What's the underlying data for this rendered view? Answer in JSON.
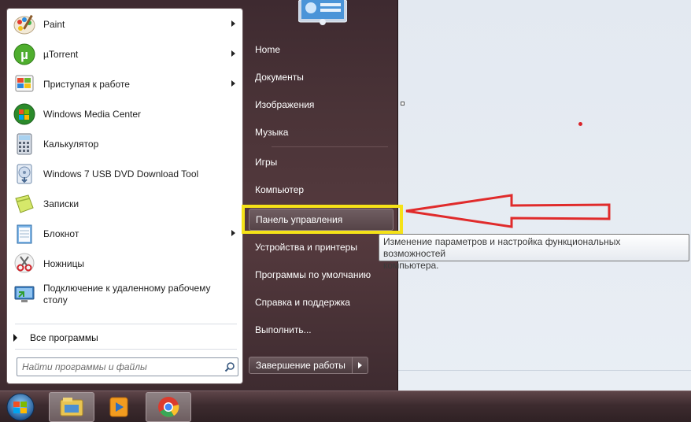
{
  "programs": [
    {
      "label": "Paint",
      "icon": "paint-icon",
      "has_submenu": true
    },
    {
      "label": "µTorrent",
      "icon": "utorrent-icon",
      "has_submenu": true
    },
    {
      "label": "Приступая к работе",
      "icon": "getting-started-icon",
      "has_submenu": true
    },
    {
      "label": "Windows Media Center",
      "icon": "media-center-icon",
      "has_submenu": false
    },
    {
      "label": "Калькулятор",
      "icon": "calculator-icon",
      "has_submenu": false
    },
    {
      "label": "Windows 7 USB DVD Download Tool",
      "icon": "usb-dvd-tool-icon",
      "has_submenu": false
    },
    {
      "label": "Записки",
      "icon": "sticky-notes-icon",
      "has_submenu": false
    },
    {
      "label": "Блокнот",
      "icon": "notepad-icon",
      "has_submenu": true
    },
    {
      "label": "Ножницы",
      "icon": "scissors-icon",
      "has_submenu": false
    },
    {
      "label": "Подключение к удаленному рабочему столу",
      "icon": "remote-desktop-icon",
      "has_submenu": false
    }
  ],
  "all_programs": "Все программы",
  "search": {
    "placeholder": "Найти программы и файлы"
  },
  "right_menu": [
    {
      "label": "Home"
    },
    {
      "label": "Документы"
    },
    {
      "label": "Изображения"
    },
    {
      "label": "Музыка"
    },
    {
      "label": "Игры"
    },
    {
      "label": "Компьютер"
    },
    {
      "label": "Панель управления"
    },
    {
      "label": "Устройства и принтеры"
    },
    {
      "label": "Программы по умолчанию"
    },
    {
      "label": "Справка и поддержка"
    },
    {
      "label": "Выполнить..."
    }
  ],
  "shutdown": {
    "label": "Завершение работы"
  },
  "tooltip": {
    "line1": "Изменение параметров и настройка функциональных возможностей",
    "line2": "компьютера."
  },
  "taskbar": {
    "items": [
      {
        "icon": "windows-explorer-icon",
        "active": true
      },
      {
        "icon": "media-player-icon",
        "active": false
      },
      {
        "icon": "chrome-icon",
        "active": true
      }
    ]
  },
  "colors": {
    "annotation_arrow": "#e02b2b",
    "highlight_box": "#f5e218",
    "menu_dark": "#4b3438"
  }
}
